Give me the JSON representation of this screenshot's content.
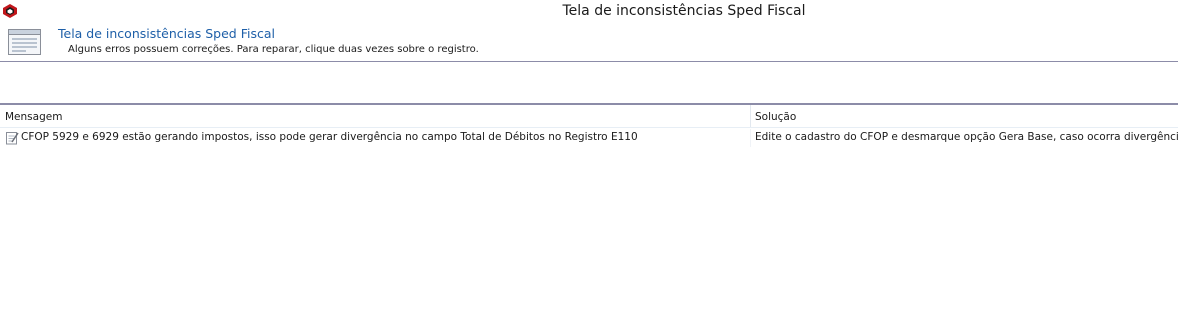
{
  "window": {
    "title": "Tela de inconsistências Sped Fiscal",
    "app_icon": "app-logo-icon"
  },
  "header": {
    "icon": "form-window-icon",
    "title": "Tela de inconsistências Sped Fiscal",
    "subtitle": "Alguns erros possuem correções. Para reparar, clique duas vezes sobre o registro."
  },
  "grid": {
    "columns": [
      "Mensagem",
      "Solução"
    ],
    "rows": [
      {
        "icon": "note-edit-icon",
        "mensagem": "CFOP 5929 e 6929 estão gerando impostos, isso pode gerar divergência no campo Total de Débitos no Registro E110",
        "solucao": "Edite o cadastro do CFOP e desmarque opção Gera Base, caso ocorra divergência"
      }
    ]
  },
  "colors": {
    "header_title": "#1e5fa8",
    "separator": "#8c8ca8",
    "logo_red": "#c0161b"
  }
}
